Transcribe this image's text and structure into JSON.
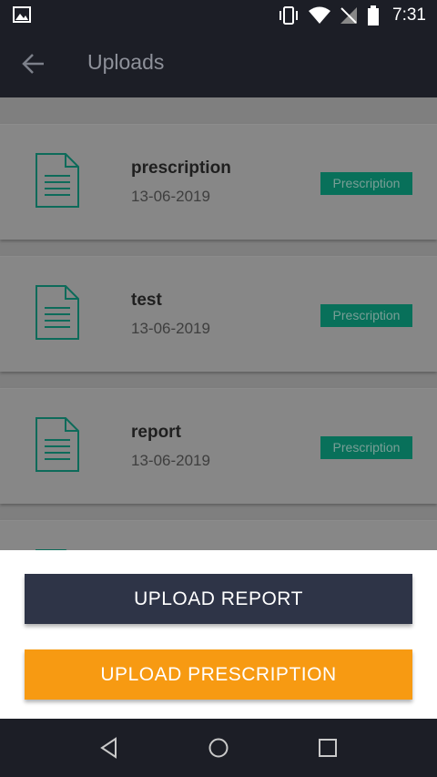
{
  "status_bar": {
    "time": "7:31",
    "icons": [
      "image-icon",
      "vibrate-icon",
      "wifi-icon",
      "no-signal-icon",
      "battery-icon"
    ]
  },
  "app_bar": {
    "title": "Uploads",
    "back_icon": "arrow-left-icon"
  },
  "uploads": [
    {
      "name": "prescription",
      "date": "13-06-2019",
      "tag": "Prescription"
    },
    {
      "name": "test",
      "date": "13-06-2019",
      "tag": "Prescription"
    },
    {
      "name": "report",
      "date": "13-06-2019",
      "tag": "Prescription"
    }
  ],
  "sheet": {
    "upload_report_label": "UPLOAD REPORT",
    "upload_prescription_label": "UPLOAD PRESCRIPTION"
  },
  "nav_bar": {
    "icons": [
      "back-triangle-icon",
      "home-circle-icon",
      "recents-square-icon"
    ]
  },
  "colors": {
    "app_bar_bg": "#1c1e26",
    "report_button_bg": "#2e3447",
    "prescription_button_bg": "#f79a12",
    "tag_bg": "#08705a",
    "doc_icon_stroke": "#0d6b5a"
  }
}
